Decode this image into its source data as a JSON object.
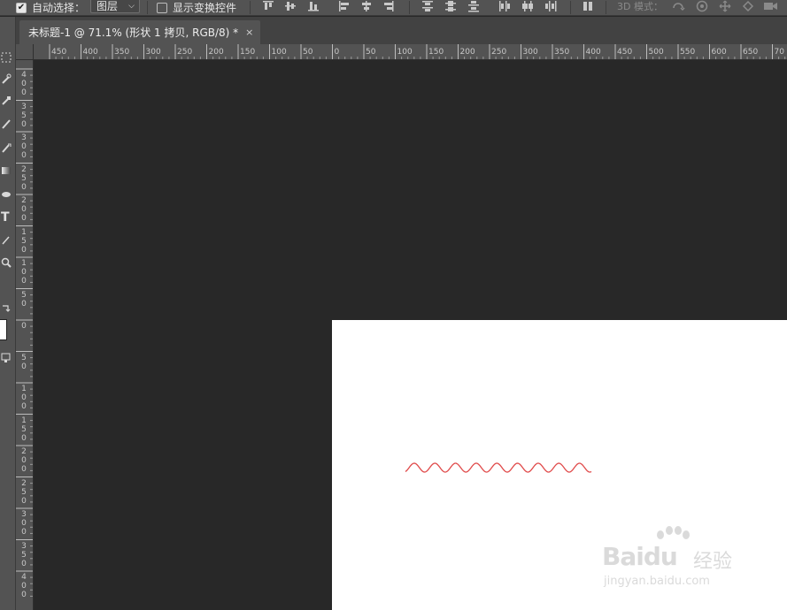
{
  "options_bar": {
    "auto_select_checked": true,
    "auto_select_label": "自动选择：",
    "auto_select_target": "图层",
    "show_transform_checked": false,
    "show_transform_label": "显示变换控件",
    "mode_3d_label": "3D 模式："
  },
  "document_tab": {
    "title": "未标题-1 @ 71.1% (形状 1 拷贝, RGB/8) *",
    "close_glyph": "×"
  },
  "ruler_h_labels": [
    "450",
    "400",
    "350",
    "300",
    "250",
    "200",
    "150",
    "100",
    "50",
    "0",
    "50",
    "100",
    "150",
    "200",
    "250",
    "300",
    "350",
    "400",
    "450",
    "500",
    "550",
    "600",
    "650",
    "70"
  ],
  "ruler_v_labels": [
    "400",
    "350",
    "300",
    "250",
    "200",
    "150",
    "100",
    "50",
    "0",
    "50",
    "100",
    "150",
    "200",
    "250",
    "300",
    "350",
    "400"
  ],
  "canvas": {
    "background": "#ffffff",
    "shape_color": "#e04a4a"
  },
  "watermark": {
    "brand": "Baidu",
    "cn": "经验",
    "url": "jingyan.baidu.com"
  },
  "colors": {
    "workspace": "#282828",
    "panel": "#535353"
  }
}
